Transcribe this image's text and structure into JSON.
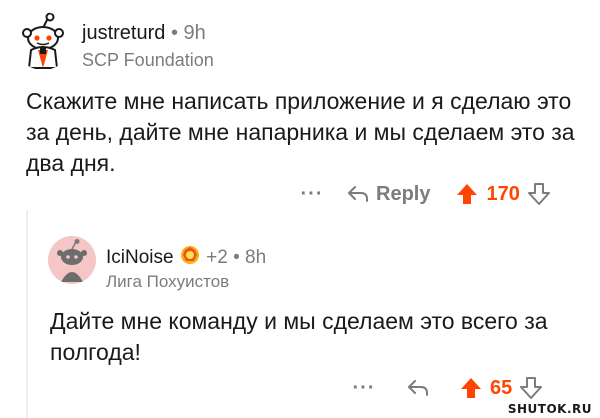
{
  "comments": [
    {
      "username": "justreturd",
      "separator": "•",
      "time": "9h",
      "flair": "SCP Foundation",
      "body": "Скажите мне написать приложение и я сделаю это за день, дайте мне напарника и мы сделаем это за два дня.",
      "actions": {
        "more": "···",
        "reply": "Reply",
        "score": "170"
      },
      "icons": {
        "avatar": "snoo-avatar-icon",
        "reply": "reply-arrow-icon",
        "upvote": "upvote-arrow-icon",
        "downvote": "downvote-arrow-icon"
      }
    },
    {
      "username": "IciNoise",
      "award_count": "+2",
      "separator": "•",
      "time": "8h",
      "flair": "Лига Похуистов",
      "body": "Дайте мне команду и мы сделаем это всего за полгода!",
      "actions": {
        "more": "···",
        "score": "65"
      },
      "icons": {
        "avatar": "snoo-avatar-icon",
        "award": "award-icon",
        "reply": "reply-arrow-icon",
        "upvote": "upvote-arrow-icon",
        "downvote": "downvote-arrow-icon"
      }
    }
  ],
  "colors": {
    "upvote": "#ff4500",
    "muted": "#7c7c7c",
    "text": "#1a1a1b"
  },
  "watermark": "SHUTOK.RU"
}
